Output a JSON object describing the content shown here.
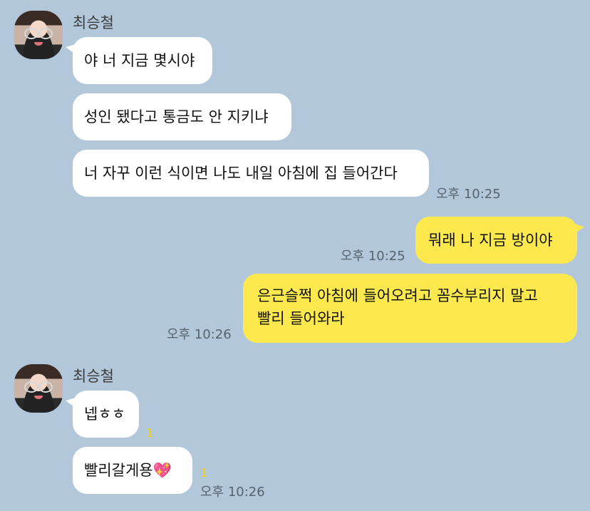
{
  "contact": {
    "name": "최승철"
  },
  "messages": {
    "m1": "야 너 지금 몇시야",
    "m2": "성인 됐다고 통금도 안 지키냐",
    "m3": "너 자꾸 이런 식이면 나도 내일 아침에 집 들어간다",
    "m4": "뭐래 나 지금 방이야",
    "m5_line1": "은근슬쩍 아침에 들어오려고 꼼수부리지 말고",
    "m5_line2": "빨리 들어와라",
    "m6": "넵ㅎㅎ",
    "m7": "빨리갈게용",
    "m7_emoji": "💖"
  },
  "times": {
    "t1": "오후 10:25",
    "t2": "오후 10:25",
    "t3": "오후 10:26",
    "t4": "오후 10:26"
  },
  "unread": {
    "u1": "1",
    "u2": "1"
  },
  "colors": {
    "background": "#b2c7d9",
    "incoming_bubble": "#ffffff",
    "outgoing_bubble": "#fde94d",
    "unread_count": "#f2d21b"
  }
}
